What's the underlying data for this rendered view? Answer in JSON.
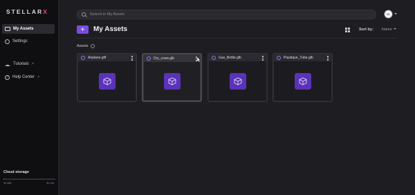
{
  "brand": {
    "logo_text": "STELLAR",
    "logo_accent": "X"
  },
  "sidebar": {
    "items": [
      {
        "label": "My Assets",
        "icon": "folder-icon",
        "active": true
      },
      {
        "label": "Settings",
        "icon": "gear-icon",
        "active": false
      },
      {
        "label": "Tutorials",
        "icon": "graduation-cap-icon",
        "external": true
      },
      {
        "label": "Help Center",
        "icon": "help-icon",
        "external": true
      }
    ],
    "storage": {
      "title": "Cloud storage",
      "used_label": "90 MB",
      "total_label": "50 GB",
      "used_fraction": 0.002
    }
  },
  "header": {
    "search_placeholder": "Search in My Assets",
    "avatar_text": "ML"
  },
  "toolbar": {
    "add_label": "+",
    "page_title": "My Assets",
    "sort_label": "Sort by:",
    "sort_value": "Name"
  },
  "section": {
    "label": "Assets"
  },
  "assets": [
    {
      "name": "Airplane.gltf"
    },
    {
      "name": "Dry_cows.glb"
    },
    {
      "name": "Gas_Bottle.glb"
    },
    {
      "name": "Plastique_Tube.glb"
    }
  ],
  "colors": {
    "accent": "#7a4de0",
    "cube_bg": "#5a33b8",
    "background": "#1e1e22",
    "sidebar": "#0f0f12"
  }
}
